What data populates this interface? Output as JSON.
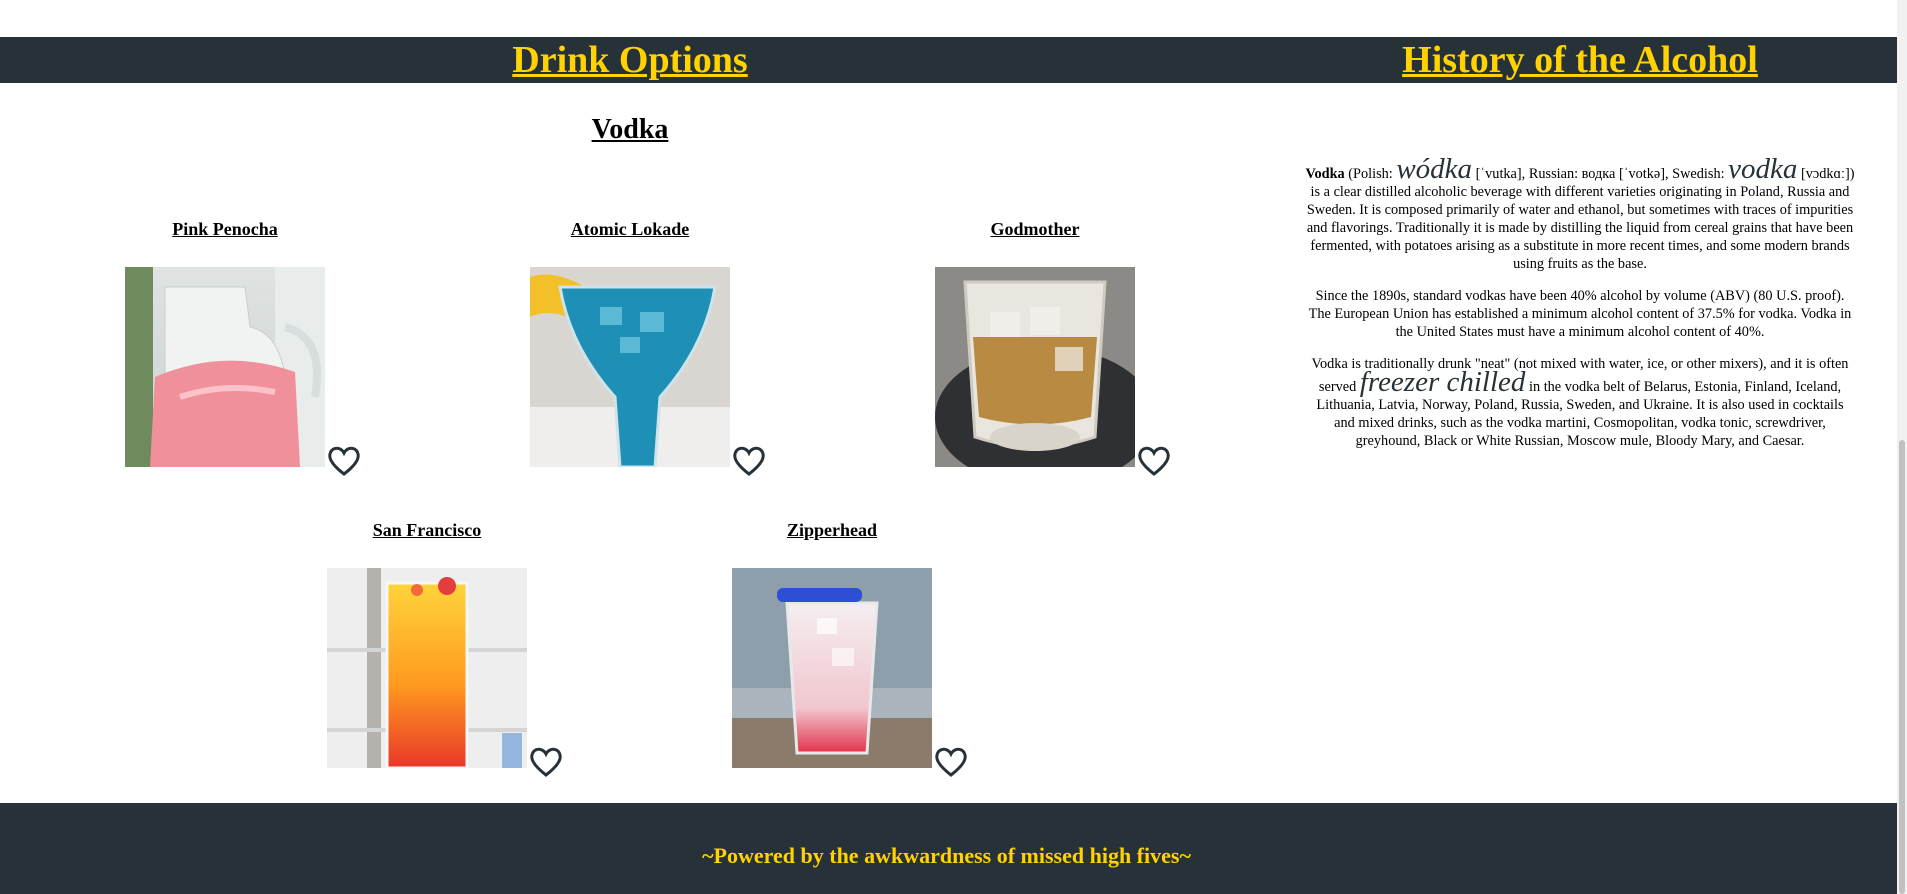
{
  "nav": {
    "drink_options": "Drink Options",
    "history": "History of the Alcohol"
  },
  "section": {
    "title": "Vodka"
  },
  "drinks": [
    {
      "name": "Pink Penocha",
      "image": "pink punch pitcher"
    },
    {
      "name": "Atomic Lokade",
      "image": "blue cocktail with lemon"
    },
    {
      "name": "Godmother",
      "image": "amber drink on ice"
    },
    {
      "name": "San Francisco",
      "image": "orange red layered drink"
    },
    {
      "name": "Zipperhead",
      "image": "pink drink with blue stir stick"
    }
  ],
  "history": {
    "p1_lead": "Vodka",
    "p1_a": " (Polish: ",
    "p1_polish": "wódka",
    "p1_b": " [ˈvutka], Russian: водка [ˈvotkə], Swedish: ",
    "p1_swedish": "vodka",
    "p1_c": " [vɔdkɑː]) is a clear distilled alcoholic beverage with different varieties originating in Poland, Russia and Sweden. It is composed primarily of water and ethanol, but sometimes with traces of impurities and flavorings. Traditionally it is made by distilling the liquid from cereal grains that have been fermented, with potatoes arising as a substitute in more recent times, and some modern brands using fruits as the base.",
    "p2": "Since the 1890s, standard vodkas have been 40% alcohol by volume (ABV) (80 U.S. proof). The European Union has established a minimum alcohol content of 37.5% for vodka. Vodka in the United States must have a minimum alcohol content of 40%.",
    "p3_a": "Vodka is traditionally drunk \"neat\" (not mixed with water, ice, or other mixers), and it is often served ",
    "p3_em": "freezer chilled",
    "p3_b": " in the vodka belt of Belarus, Estonia, Finland, Iceland, Lithuania, Latvia, Norway, Poland, Russia, Sweden, and Ukraine. It is also used in cocktails and mixed drinks, such as the vodka martini, Cosmopolitan, vodka tonic, screwdriver, greyhound, Black or White Russian, Moscow mule, Bloody Mary, and Caesar."
  },
  "footer": {
    "text": "~Powered by the awkwardness of missed high fives~"
  },
  "colors": {
    "band": "#273238",
    "accent": "#ffd200"
  },
  "icons": {
    "favorite": "heart-outline-icon"
  }
}
